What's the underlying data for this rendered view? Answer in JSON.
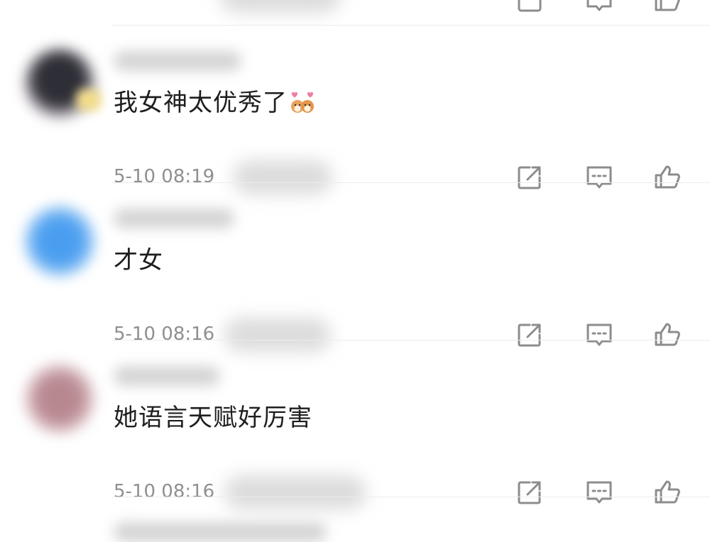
{
  "comments": [
    {
      "text": "我女神太优秀了",
      "time": "5-10 08:19",
      "emoji": "shiba-dog-hearts-emoji",
      "avatar_color": "#3c3c42"
    },
    {
      "text": "才女",
      "time": "5-10 08:16",
      "avatar_color": "#5aaaf0"
    },
    {
      "text": "她语言天赋好厉害",
      "time": "5-10 08:16",
      "avatar_color": "#c49aa0"
    }
  ],
  "icons": {
    "share": "share-icon",
    "reply": "comment-icon",
    "like": "thumbs-up-icon"
  },
  "colors": {
    "text": "#1e1e1e",
    "meta": "#8f8f8f",
    "icon": "#8c8c8c",
    "divider": "#ececec"
  }
}
